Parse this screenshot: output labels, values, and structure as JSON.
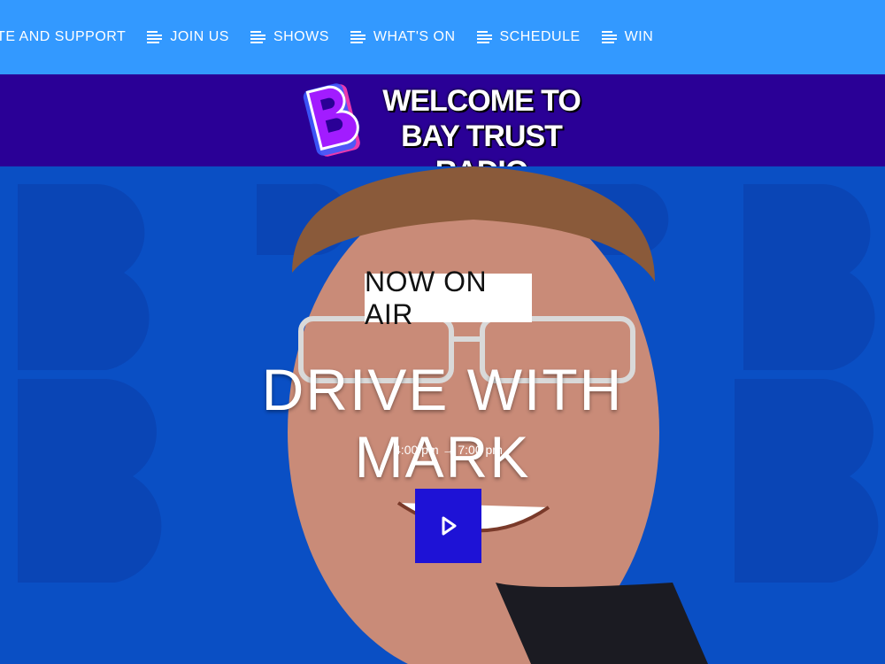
{
  "nav": {
    "items": [
      {
        "label": "NATE AND SUPPORT",
        "icon": "menu-lines-icon"
      },
      {
        "label": "JOIN US",
        "icon": "menu-lines-icon"
      },
      {
        "label": "SHOWS",
        "icon": "menu-lines-icon"
      },
      {
        "label": "WHAT'S ON",
        "icon": "menu-lines-icon"
      },
      {
        "label": "SCHEDULE",
        "icon": "menu-lines-icon"
      },
      {
        "label": "WIN",
        "icon": "menu-lines-icon"
      }
    ]
  },
  "banner": {
    "logo_icon": "b-logo-icon",
    "welcome_line1": "WELCOME TO",
    "welcome_line2": "BAY TRUST RADIO"
  },
  "now_on_air": {
    "badge": "NOW ON AIR",
    "show_title": "DRIVE WITH MARK",
    "time": "4:00 pm → 7:00 pm",
    "play_icon": "play-icon"
  },
  "colors": {
    "nav_bg": "#3399ff",
    "banner_bg": "#2a0096",
    "hero_bg": "#0a4fc4",
    "play_bg": "#1e12d6",
    "logo_accent": "#a21cff"
  }
}
